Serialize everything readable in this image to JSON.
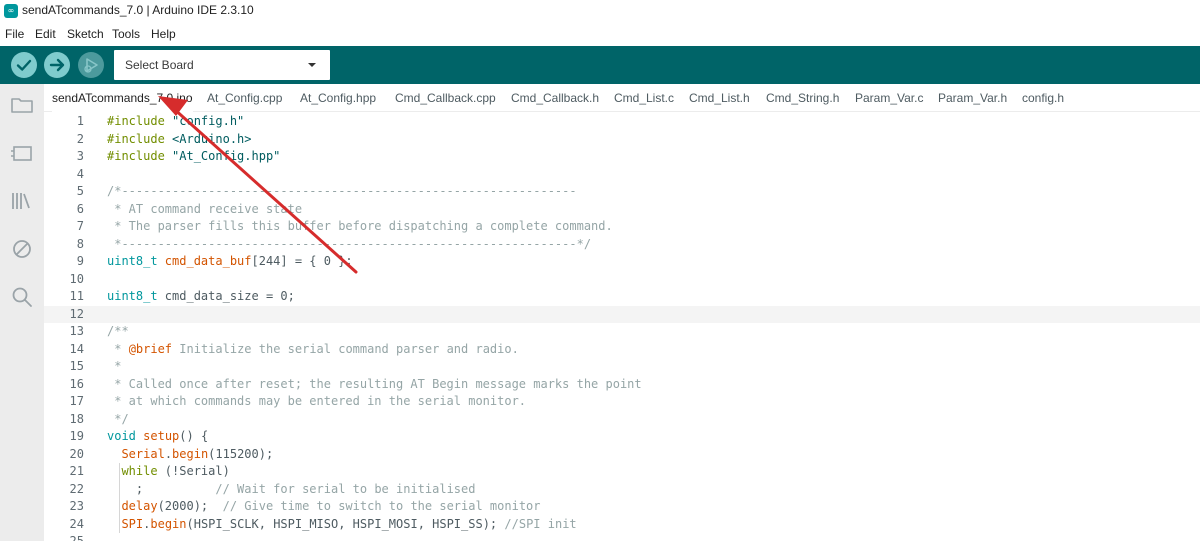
{
  "window": {
    "title": "sendATcommands_7.0 | Arduino IDE 2.3.10"
  },
  "menu": [
    "File",
    "Edit",
    "Sketch",
    "Tools",
    "Help"
  ],
  "toolbar": {
    "verify_icon": "check-icon",
    "upload_icon": "arrow-right-icon",
    "debug_icon": "debug-icon",
    "board_select": "Select Board"
  },
  "sidebar": [
    "folder-icon",
    "board-icon",
    "library-icon",
    "debug-circle-icon",
    "search-icon"
  ],
  "tabs": [
    "sendATcommands_7.0.ino",
    "At_Config.cpp",
    "At_Config.hpp",
    "Cmd_Callback.cpp",
    "Cmd_Callback.h",
    "Cmd_List.c",
    "Cmd_List.h",
    "Cmd_String.h",
    "Param_Var.c",
    "Param_Var.h",
    "config.h"
  ],
  "active_tab": "sendATcommands_7.0.ino",
  "code": {
    "line_numbers": [
      "1",
      "2",
      "3",
      "4",
      "5",
      "6",
      "7",
      "8",
      "9",
      "10",
      "11",
      "12",
      "13",
      "14",
      "15",
      "16",
      "17",
      "18",
      "19",
      "20",
      "21",
      "22",
      "23",
      "24",
      "25"
    ],
    "lines": [
      [
        {
          "t": "#include ",
          "c": "dir"
        },
        {
          "t": "\"config.h\"",
          "c": "str"
        }
      ],
      [
        {
          "t": "#include ",
          "c": "dir"
        },
        {
          "t": "<Arduino.h>",
          "c": "str"
        }
      ],
      [
        {
          "t": "#include ",
          "c": "dir"
        },
        {
          "t": "\"At_Config.hpp\"",
          "c": "str"
        }
      ],
      [],
      [
        {
          "t": "/*---------------------------------------------------------------",
          "c": "com"
        }
      ],
      [
        {
          "t": " * AT command receive state",
          "c": "com"
        }
      ],
      [
        {
          "t": " * The parser fills this buffer before dispatching a complete command.",
          "c": "com"
        }
      ],
      [
        {
          "t": " *---------------------------------------------------------------*/",
          "c": "com"
        }
      ],
      [
        {
          "t": "uint8_t",
          "c": "type"
        },
        {
          "t": " cmd_data_buf",
          "c": "fn"
        },
        {
          "t": "[244] = { 0 };",
          "c": "id"
        }
      ],
      [],
      [
        {
          "t": "uint8_t",
          "c": "type"
        },
        {
          "t": " cmd_data_size = 0;",
          "c": "id"
        }
      ],
      [],
      [
        {
          "t": "/**",
          "c": "com"
        }
      ],
      [
        {
          "t": " * ",
          "c": "com"
        },
        {
          "t": "@brief",
          "c": "fn"
        },
        {
          "t": " Initialize the serial command parser and radio.",
          "c": "com"
        }
      ],
      [
        {
          "t": " *",
          "c": "com"
        }
      ],
      [
        {
          "t": " * Called once after reset; the resulting AT Begin message marks the point",
          "c": "com"
        }
      ],
      [
        {
          "t": " * at which commands may be entered in the serial monitor.",
          "c": "com"
        }
      ],
      [
        {
          "t": " */",
          "c": "com"
        }
      ],
      [
        {
          "t": "void",
          "c": "type"
        },
        {
          "t": " ",
          "c": "id"
        },
        {
          "t": "setup",
          "c": "fn"
        },
        {
          "t": "() {",
          "c": "id"
        }
      ],
      [
        {
          "t": "  ",
          "c": "id"
        },
        {
          "t": "Serial",
          "c": "fn"
        },
        {
          "t": ".",
          "c": "id"
        },
        {
          "t": "begin",
          "c": "fn"
        },
        {
          "t": "(115200);",
          "c": "id"
        }
      ],
      [
        {
          "t": "  ",
          "c": "id"
        },
        {
          "t": "while",
          "c": "kw"
        },
        {
          "t": " (!Serial)",
          "c": "id"
        }
      ],
      [
        {
          "t": "    ;          ",
          "c": "id"
        },
        {
          "t": "// Wait for serial to be initialised",
          "c": "com"
        }
      ],
      [
        {
          "t": "  ",
          "c": "id"
        },
        {
          "t": "delay",
          "c": "fn"
        },
        {
          "t": "(2000);  ",
          "c": "id"
        },
        {
          "t": "// Give time to switch to the serial monitor",
          "c": "com"
        }
      ],
      [
        {
          "t": "  ",
          "c": "id"
        },
        {
          "t": "SPI",
          "c": "fn"
        },
        {
          "t": ".",
          "c": "id"
        },
        {
          "t": "begin",
          "c": "fn"
        },
        {
          "t": "(HSPI_SCLK, HSPI_MISO, HSPI_MOSI, HSPI_SS); ",
          "c": "id"
        },
        {
          "t": "//SPI init",
          "c": "com"
        }
      ],
      []
    ],
    "current_line": "12"
  },
  "annotation": {
    "type": "red-arrow",
    "color": "#d62c2c",
    "points_to": "sendATcommands_7.0.ino"
  }
}
